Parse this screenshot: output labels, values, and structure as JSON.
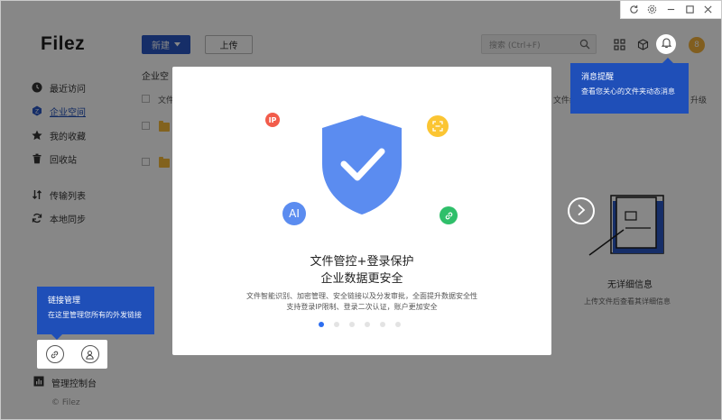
{
  "app": {
    "logo": "Filez",
    "copyright": "© Filez"
  },
  "sidebar": {
    "items": [
      {
        "label": "最近访问",
        "icon": "clock-icon"
      },
      {
        "label": "企业空间",
        "icon": "enterprise-icon",
        "active": true
      },
      {
        "label": "我的收藏",
        "icon": "star-icon"
      },
      {
        "label": "回收站",
        "icon": "trash-icon"
      },
      {
        "label": "传输列表",
        "icon": "transfer-icon"
      },
      {
        "label": "本地同步",
        "icon": "sync-icon"
      }
    ],
    "console": "管理控制台"
  },
  "header": {
    "new_label": "新建",
    "upload_label": "上传",
    "search_placeholder": "搜索   (Ctrl+F)",
    "avatar_letter": "8"
  },
  "main": {
    "breadcrumb": "企业空",
    "col_file": "文件",
    "col_partial": "文件级",
    "col_upgrade": "升级"
  },
  "detail": {
    "title": "无详细信息",
    "desc": "上传文件后查看其详细信息"
  },
  "tooltips": {
    "notify_title": "消息提醒",
    "notify_desc": "查看您关心的文件夹动态消息",
    "link_title": "链接管理",
    "link_desc": "在这里管理您所有的外发链接"
  },
  "modal": {
    "title_line1": "文件管控+登录保护",
    "title_line2": "企业数据更安全",
    "desc_line1": "文件智能识别、加密管理、安全链接以及分发审批，全面提升数据安全性",
    "desc_line2": "支持登录IP限制、登录二次认证，账户更加安全",
    "badge_ip": "IP",
    "badge_ai": "AI",
    "slide_count": 6,
    "active_slide": 0
  },
  "colors": {
    "primary": "#2a58c4",
    "tooltip": "#1f4fb8",
    "shield": "#5b8cf0",
    "dot_active": "#2d6ef0"
  }
}
